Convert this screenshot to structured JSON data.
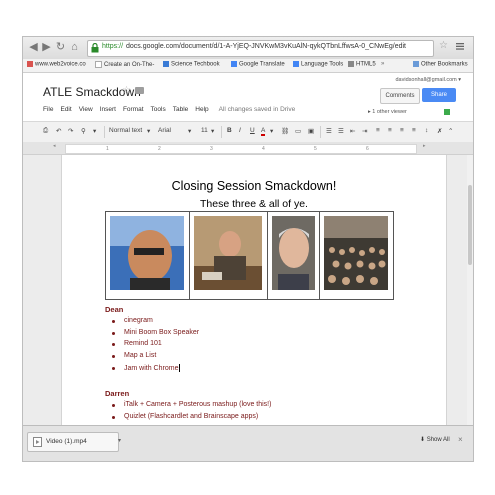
{
  "browser": {
    "url_https": "https://",
    "url_rest": "docs.google.com/document/d/1-A-YjEQ-JNVKwM3vKuAlN-qykQTbnLffwsA-0_CNwEg/edit"
  },
  "bookmarks": [
    "www.web2voice.co",
    "Create an On-The-",
    "Science Techbook",
    "Google Translate",
    "Language Tools",
    "HTML5",
    "Other Bookmarks"
  ],
  "bookmarks_overflow": "»",
  "doc": {
    "title": "ATLE Smackdown",
    "email": "davidsonhall@gmail.com ▾",
    "comments": "Comments",
    "share": "Share",
    "menu": [
      "File",
      "Edit",
      "View",
      "Insert",
      "Format",
      "Tools",
      "Table",
      "Help"
    ],
    "saved": "All changes saved in Drive",
    "viewer": "▸ 1 other viewer"
  },
  "toolbar": {
    "style": "Normal text",
    "font": "Arial",
    "size": "11",
    "bold": "B",
    "italic": "I",
    "underline": "U",
    "textcolor": "A"
  },
  "ruler": [
    "1",
    "2",
    "3",
    "4",
    "5",
    "6"
  ],
  "content": {
    "heading": "Closing Session Smackdown!",
    "subheading": "These three & all of ye.",
    "sections": [
      {
        "name": "Dean",
        "items": [
          "cinegram",
          "Mini Boom Box Speaker",
          "Remind 101",
          "Map a List",
          "Jam with Chrome"
        ]
      },
      {
        "name": "Darren",
        "items": [
          "iTalk + Camera + Posterous mashup (love this!)",
          "Quizlet (Flashcardlet and Brainscape apps)"
        ]
      }
    ]
  },
  "downloads": {
    "file": "Video (1).mp4",
    "show_all": "Show All"
  }
}
